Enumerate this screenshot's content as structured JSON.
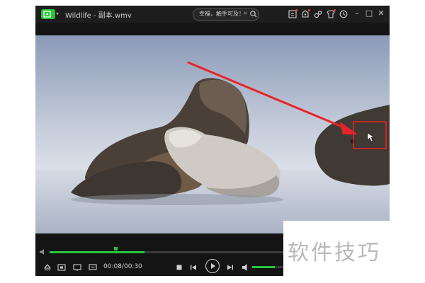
{
  "app": {
    "title": "Wildlife - 副本.wmv",
    "accent_color": "#28c43a"
  },
  "search": {
    "text": "幸福，触手可及！",
    "clear_glyph": "×"
  },
  "toolbar_icons": [
    "screen-cast-icon",
    "share-icon",
    "effects-icon",
    "skin-icon",
    "history-icon"
  ],
  "window_controls": {
    "minimize": "–",
    "maximize": "□",
    "close": "✕"
  },
  "playback": {
    "current_time": "00:08",
    "total_time": "00:30",
    "time_display": "00:08/00:30",
    "progress_fraction": 0.28,
    "volume_fraction": 0.72
  },
  "annotation": {
    "arrow_color": "#e8242a",
    "highlight_box_color": "#e8242a"
  },
  "watermark": {
    "text": "软件技巧"
  }
}
